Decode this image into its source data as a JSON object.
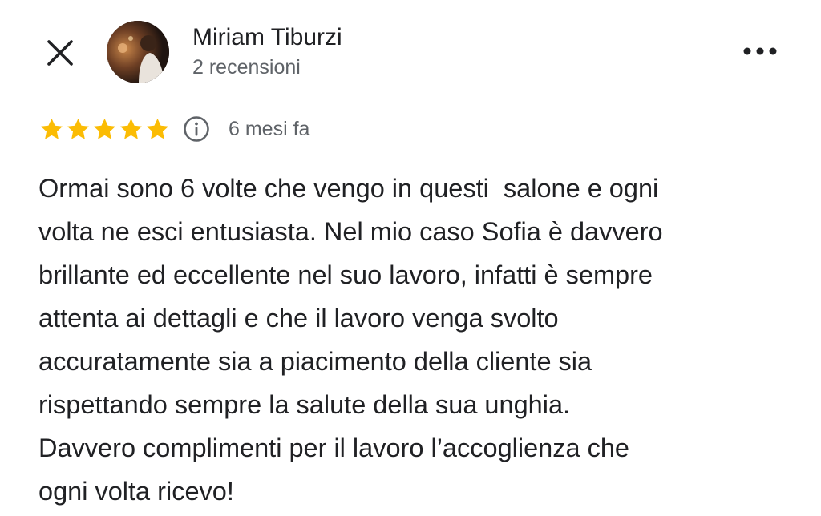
{
  "header": {
    "close_icon": "close-icon",
    "more_icon": "more-horizontal-icon",
    "author": {
      "name": "Miriam Tiburzi",
      "reviews_count": "2 recensioni",
      "avatar": "profile-photo"
    }
  },
  "review": {
    "rating": 5,
    "rating_max": 5,
    "star_color": "#fbbc04",
    "info_icon": "info-icon",
    "time_ago": "6 mesi fa",
    "text": "Ormai sono 6 volte che vengo in questi  salone e ogni\nvolta ne esci entusiasta. Nel mio caso Sofia è davvero\nbrillante ed eccellente nel suo lavoro, infatti è sempre\nattenta ai dettagli e che il lavoro venga svolto\naccuratamente sia a piacimento della cliente sia\nrispettando sempre la salute della sua unghia.\nDavvero complimenti per il lavoro l’accoglienza che\nogni volta ricevo!"
  }
}
